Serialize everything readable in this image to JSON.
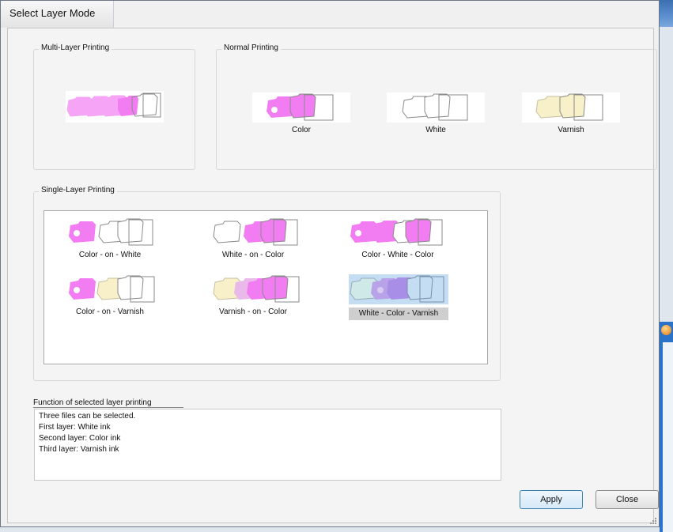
{
  "dialog": {
    "title": "Select Layer Mode"
  },
  "multi_layer": {
    "label": "Multi-Layer Printing"
  },
  "normal": {
    "label": "Normal Printing",
    "options": [
      "Color",
      "White",
      "Varnish"
    ]
  },
  "single_layer": {
    "label": "Single-Layer Printing",
    "options": [
      "Color - on - White",
      "White - on - Color",
      "Color - White - Color",
      "Color - on - Varnish",
      "Varnish - on - Color",
      "White - Color - Varnish"
    ],
    "selected": "White - Color - Varnish"
  },
  "function": {
    "label": "Function of selected layer printing",
    "lines": [
      "Three files can be selected.",
      "First layer: White ink",
      "Second layer: Color ink",
      "Third layer: Varnish ink"
    ]
  },
  "buttons": {
    "apply": "Apply",
    "close": "Close"
  },
  "colors": {
    "color_ink": "#f27df2",
    "white_ink": "#ffffff",
    "varnish_ink": "#f7f0c8",
    "selection": "#c4ddf3",
    "accent": "#3c7fb1"
  }
}
